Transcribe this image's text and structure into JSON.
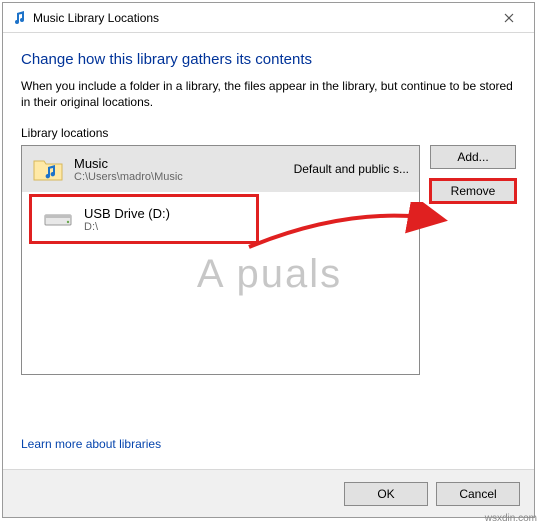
{
  "window": {
    "title": "Music Library Locations"
  },
  "main_instruction": "Change how this library gathers its contents",
  "description": "When you include a folder in a library, the files appear in the library, but continue to be stored in their original locations.",
  "section_label": "Library locations",
  "locations": {
    "items": [
      {
        "title": "Music",
        "path": "C:\\Users\\madro\\Music",
        "status": "Default and public s..."
      },
      {
        "title": "USB Drive (D:)",
        "path": "D:\\",
        "status": ""
      }
    ]
  },
  "buttons": {
    "add": "Add...",
    "remove": "Remove",
    "ok": "OK",
    "cancel": "Cancel"
  },
  "link": "Learn more about libraries",
  "watermark": "A  puals",
  "footer_brand": "wsxdin.com"
}
